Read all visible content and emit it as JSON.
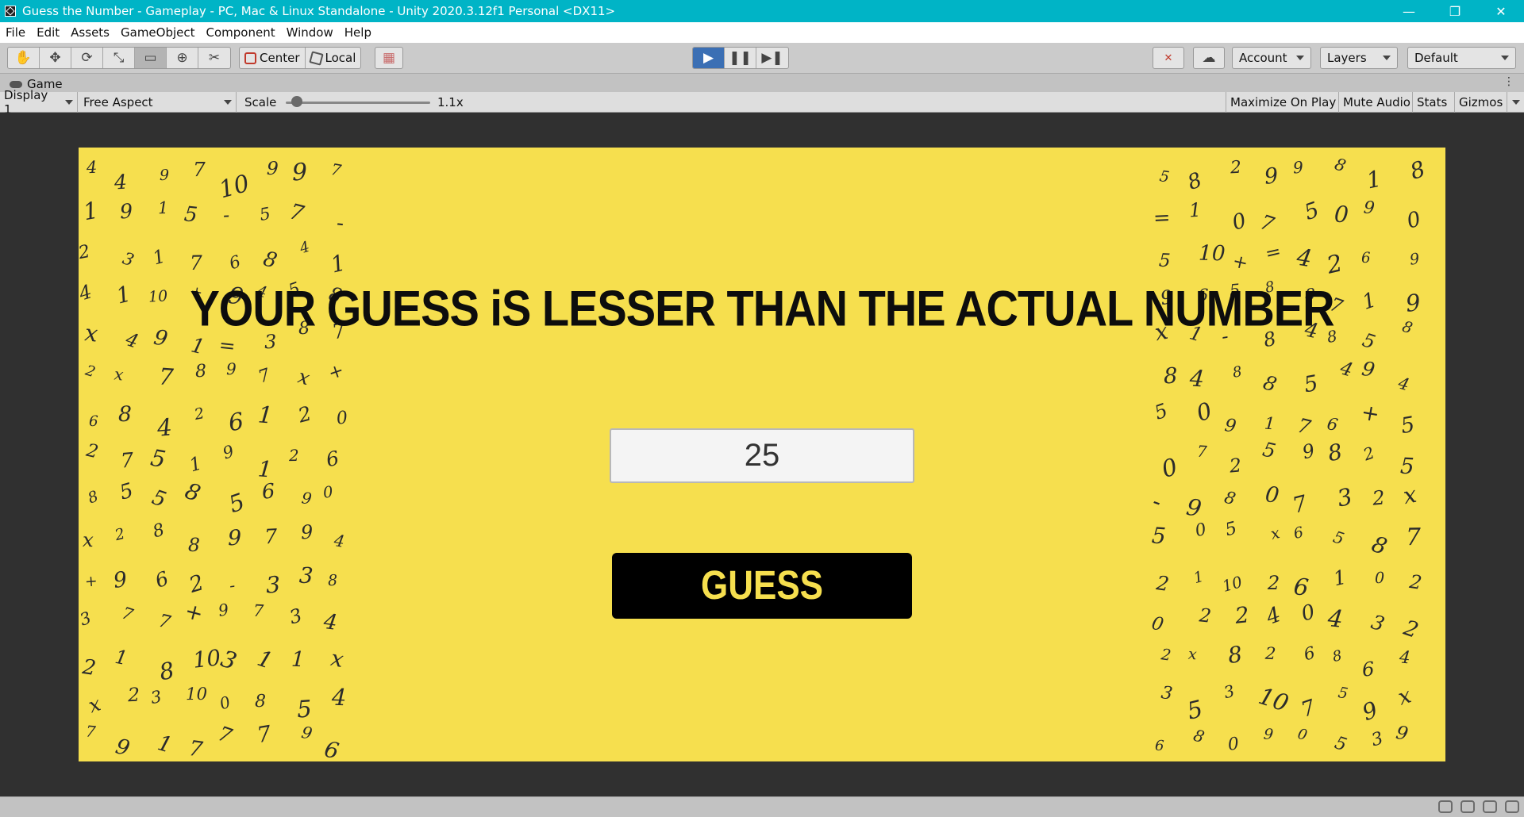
{
  "window": {
    "title": "Guess the Number - Gameplay - PC, Mac & Linux Standalone - Unity 2020.3.12f1 Personal <DX11>",
    "controls": [
      "—",
      "❐",
      "✕"
    ]
  },
  "menu": [
    "File",
    "Edit",
    "Assets",
    "GameObject",
    "Component",
    "Window",
    "Help"
  ],
  "toolbar": {
    "transform_tools": [
      "hand-icon",
      "move-icon",
      "rotate-icon",
      "scale-icon",
      "rect-tool-icon",
      "transform-icon",
      "custom-tool-icon"
    ],
    "pivot_mode": "Center",
    "pivot_rotation": "Local",
    "play_controls": [
      "play-icon",
      "pause-icon",
      "step-icon"
    ],
    "account_label": "Account",
    "layers_label": "Layers",
    "layout_label": "Default"
  },
  "game_tab": {
    "label": "Game"
  },
  "game_options": {
    "display": "Display 1",
    "aspect": "Free Aspect",
    "scale_label": "Scale",
    "scale_value": "1.1x",
    "scale_level": 0.1,
    "maximize_on_play": "Maximize On Play",
    "mute_audio": "Mute Audio",
    "stats": "Stats",
    "gizmos": "Gizmos"
  },
  "game": {
    "background_color": "#f6df4e",
    "message": "YOUR GUESS iS LESSER THAN THE ACTUAL NUMBER",
    "input_value": "25",
    "button_label": "GUESS"
  }
}
